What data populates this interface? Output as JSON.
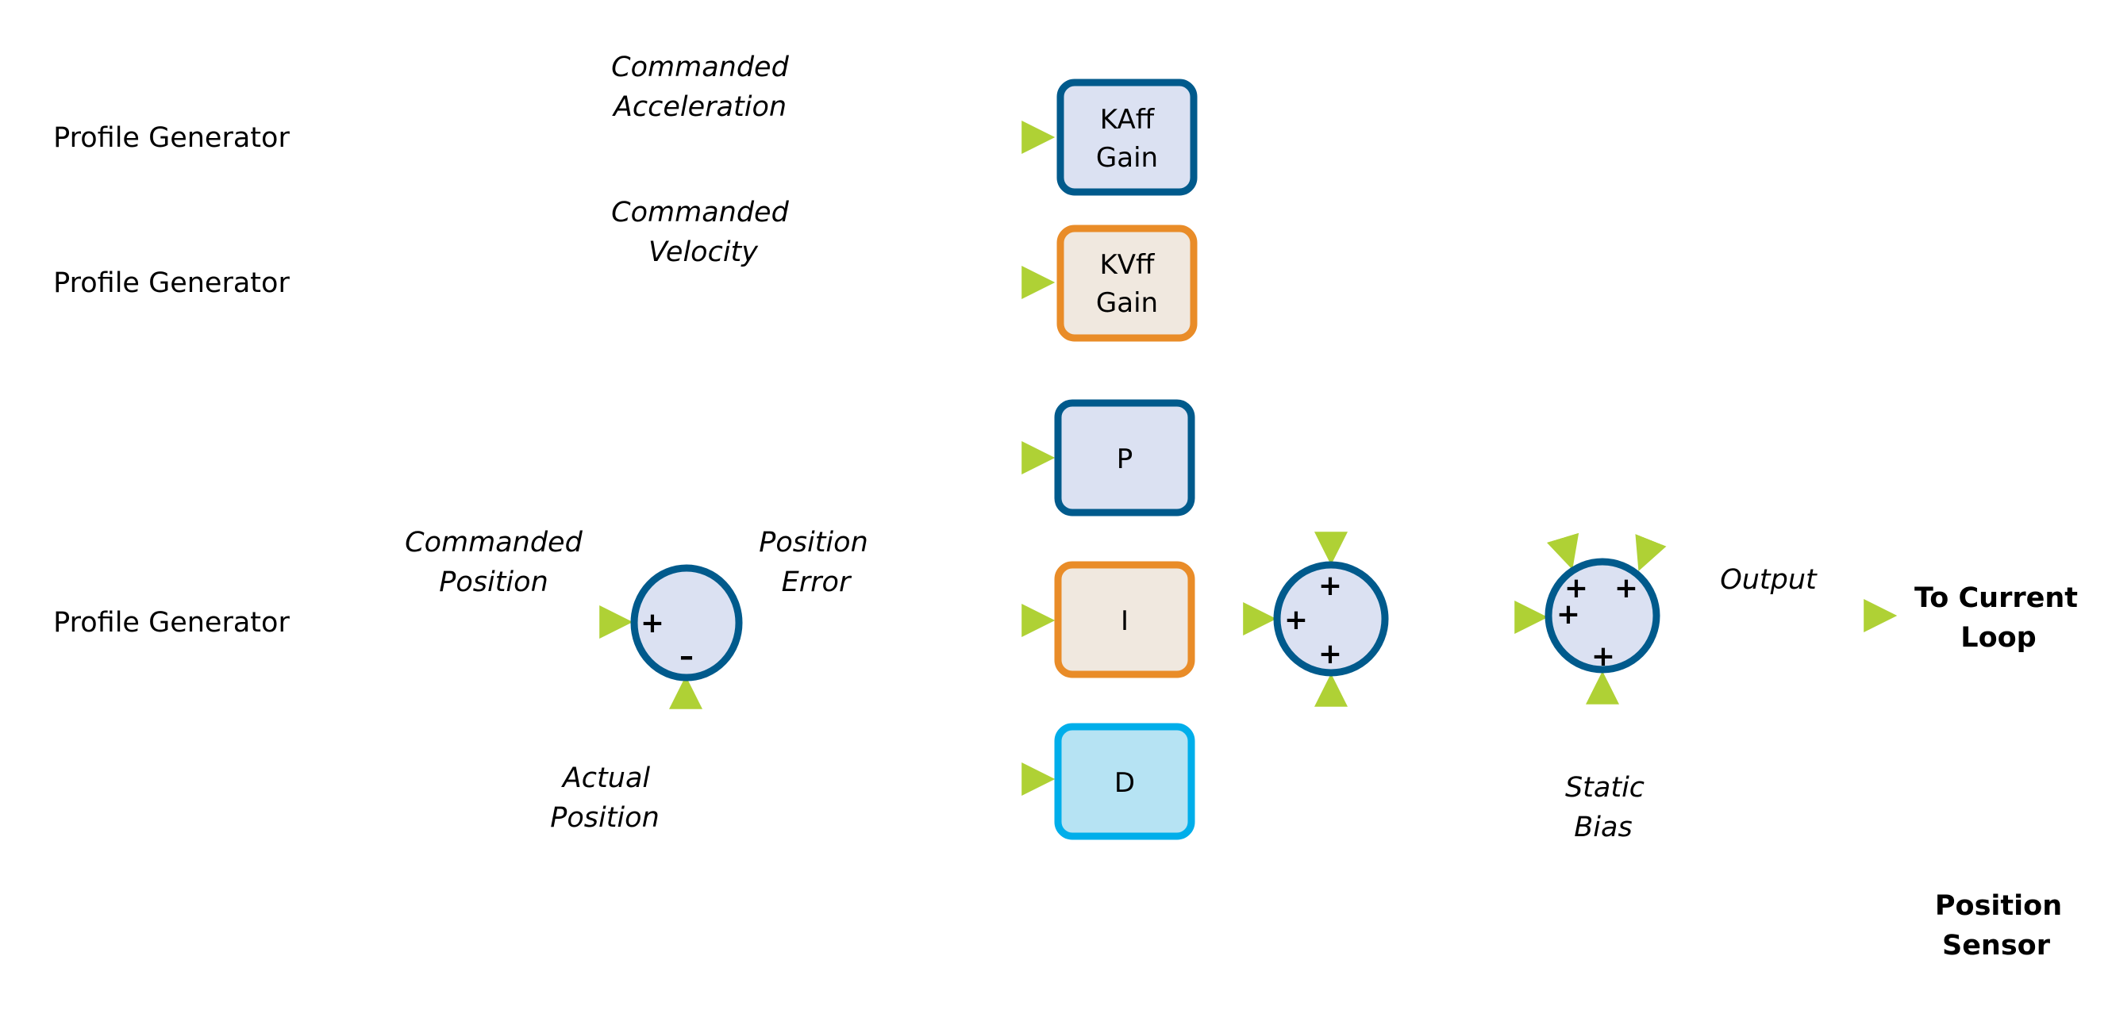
{
  "colors": {
    "wire": "#afd135",
    "blue_border": "#005a8c",
    "blue_fill": "#dbe1f2",
    "orange_border": "#e98c28",
    "orange_fill": "#f0e8df",
    "cyan_border": "#00aeea",
    "cyan_fill": "#b6e3f3"
  },
  "sources": {
    "accel": "Profile Generator",
    "velocity": "Profile Generator",
    "position": "Profile Generator"
  },
  "signals": {
    "accel": [
      "Commanded",
      "Acceleration"
    ],
    "velocity": [
      "Commanded",
      "Velocity"
    ],
    "position": [
      "Commanded",
      "Position"
    ],
    "error": [
      "Position",
      "Error"
    ],
    "actual": [
      "Actual",
      "Position"
    ],
    "bias": [
      "Static",
      "Bias"
    ],
    "output": "Output"
  },
  "blocks": {
    "kaff": [
      "KAff",
      "Gain"
    ],
    "kvff": [
      "KVff",
      "Gain"
    ],
    "p": "P",
    "i": "I",
    "d": "D"
  },
  "summers": {
    "error": {
      "signs": [
        "+",
        "–"
      ]
    },
    "pid": {
      "signs": [
        "+",
        "+",
        "+"
      ]
    },
    "output": {
      "signs": [
        "+",
        "+",
        "+",
        "+"
      ]
    }
  },
  "destinations": {
    "current_loop": [
      "To Current",
      "Loop"
    ],
    "sensor": [
      "Position",
      "Sensor"
    ]
  }
}
